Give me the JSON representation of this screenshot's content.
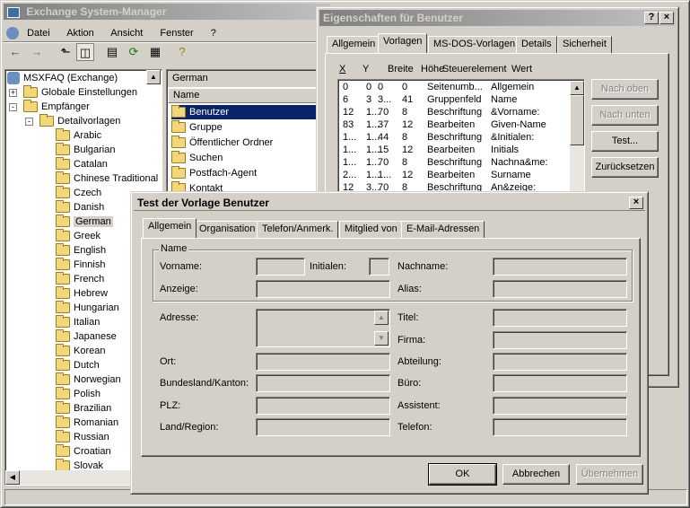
{
  "main": {
    "title": "Exchange System-Manager",
    "menu": [
      "Datei",
      "Aktion",
      "Ansicht",
      "Fenster",
      "?"
    ]
  },
  "tree": {
    "root": "MSXFAQ (Exchange)",
    "items": [
      {
        "label": "Globale Einstellungen",
        "level": 1,
        "exp": "+"
      },
      {
        "label": "Empfänger",
        "level": 1,
        "exp": "-"
      },
      {
        "label": "Detailvorlagen",
        "level": 2,
        "exp": "-"
      },
      {
        "label": "Arabic",
        "level": 3
      },
      {
        "label": "Bulgarian",
        "level": 3
      },
      {
        "label": "Catalan",
        "level": 3
      },
      {
        "label": "Chinese Traditional",
        "level": 3
      },
      {
        "label": "Czech",
        "level": 3
      },
      {
        "label": "Danish",
        "level": 3
      },
      {
        "label": "German",
        "level": 3,
        "sel": true
      },
      {
        "label": "Greek",
        "level": 3
      },
      {
        "label": "English",
        "level": 3
      },
      {
        "label": "Finnish",
        "level": 3
      },
      {
        "label": "French",
        "level": 3
      },
      {
        "label": "Hebrew",
        "level": 3
      },
      {
        "label": "Hungarian",
        "level": 3
      },
      {
        "label": "Italian",
        "level": 3
      },
      {
        "label": "Japanese",
        "level": 3
      },
      {
        "label": "Korean",
        "level": 3
      },
      {
        "label": "Dutch",
        "level": 3
      },
      {
        "label": "Norwegian",
        "level": 3
      },
      {
        "label": "Polish",
        "level": 3
      },
      {
        "label": "Brazilian",
        "level": 3
      },
      {
        "label": "Romanian",
        "level": 3
      },
      {
        "label": "Russian",
        "level": 3
      },
      {
        "label": "Croatian",
        "level": 3
      },
      {
        "label": "Slovak",
        "level": 3
      }
    ]
  },
  "rightpane": {
    "header": "German",
    "column": "Name",
    "items": [
      "Benutzer",
      "Gruppe",
      "Öffentlicher Ordner",
      "Suchen",
      "Postfach-Agent",
      "Kontakt"
    ]
  },
  "props": {
    "title": "Eigenschaften für Benutzer",
    "tabs": [
      "Allgemein",
      "Vorlagen",
      "MS-DOS-Vorlagen",
      "Details",
      "Sicherheit"
    ],
    "cols": [
      "X",
      "Y",
      "Breite",
      "Höhe",
      "Steuerelement",
      "Wert"
    ],
    "rows": [
      [
        "0",
        "0",
        "0",
        "0",
        "Seitenumb...",
        "Allgemein"
      ],
      [
        "6",
        "3",
        "3...",
        "41",
        "Gruppenfeld",
        "Name"
      ],
      [
        "12",
        "1...",
        "70",
        "8",
        "Beschriftung",
        "&Vorname:"
      ],
      [
        "83",
        "1...",
        "37",
        "12",
        "Bearbeiten",
        "Given-Name"
      ],
      [
        "1...",
        "1...",
        "44",
        "8",
        "Beschriftung",
        "&Initialen:"
      ],
      [
        "1...",
        "1...",
        "15",
        "12",
        "Bearbeiten",
        "Initials"
      ],
      [
        "1...",
        "1...",
        "70",
        "8",
        "Beschriftung",
        "Nachna&me:"
      ],
      [
        "2...",
        "1...",
        "1...",
        "12",
        "Bearbeiten",
        "Surname"
      ],
      [
        "12",
        "3...",
        "70",
        "8",
        "Beschriftung",
        "An&zeige:"
      ]
    ],
    "buttons": [
      "Nach oben",
      "Nach unten",
      "Test...",
      "Zurücksetzen"
    ]
  },
  "test": {
    "title": "Test der Vorlage Benutzer",
    "tabs": [
      "Allgemein",
      "Organisation",
      "Telefon/Anmerk.",
      "Mitglied von",
      "E-Mail-Adressen"
    ],
    "group": "Name",
    "labels": {
      "vorname": "Vorname:",
      "initialen": "Initialen:",
      "nachname": "Nachname:",
      "anzeige": "Anzeige:",
      "alias": "Alias:",
      "adresse": "Adresse:",
      "titel": "Titel:",
      "firma": "Firma:",
      "ort": "Ort:",
      "abteilung": "Abteilung:",
      "bundesland": "Bundesland/Kanton:",
      "buero": "Büro:",
      "plz": "PLZ:",
      "assistent": "Assistent:",
      "land": "Land/Region:",
      "telefon": "Telefon:"
    },
    "buttons": {
      "ok": "OK",
      "cancel": "Abbrechen",
      "apply": "Übernehmen"
    }
  }
}
